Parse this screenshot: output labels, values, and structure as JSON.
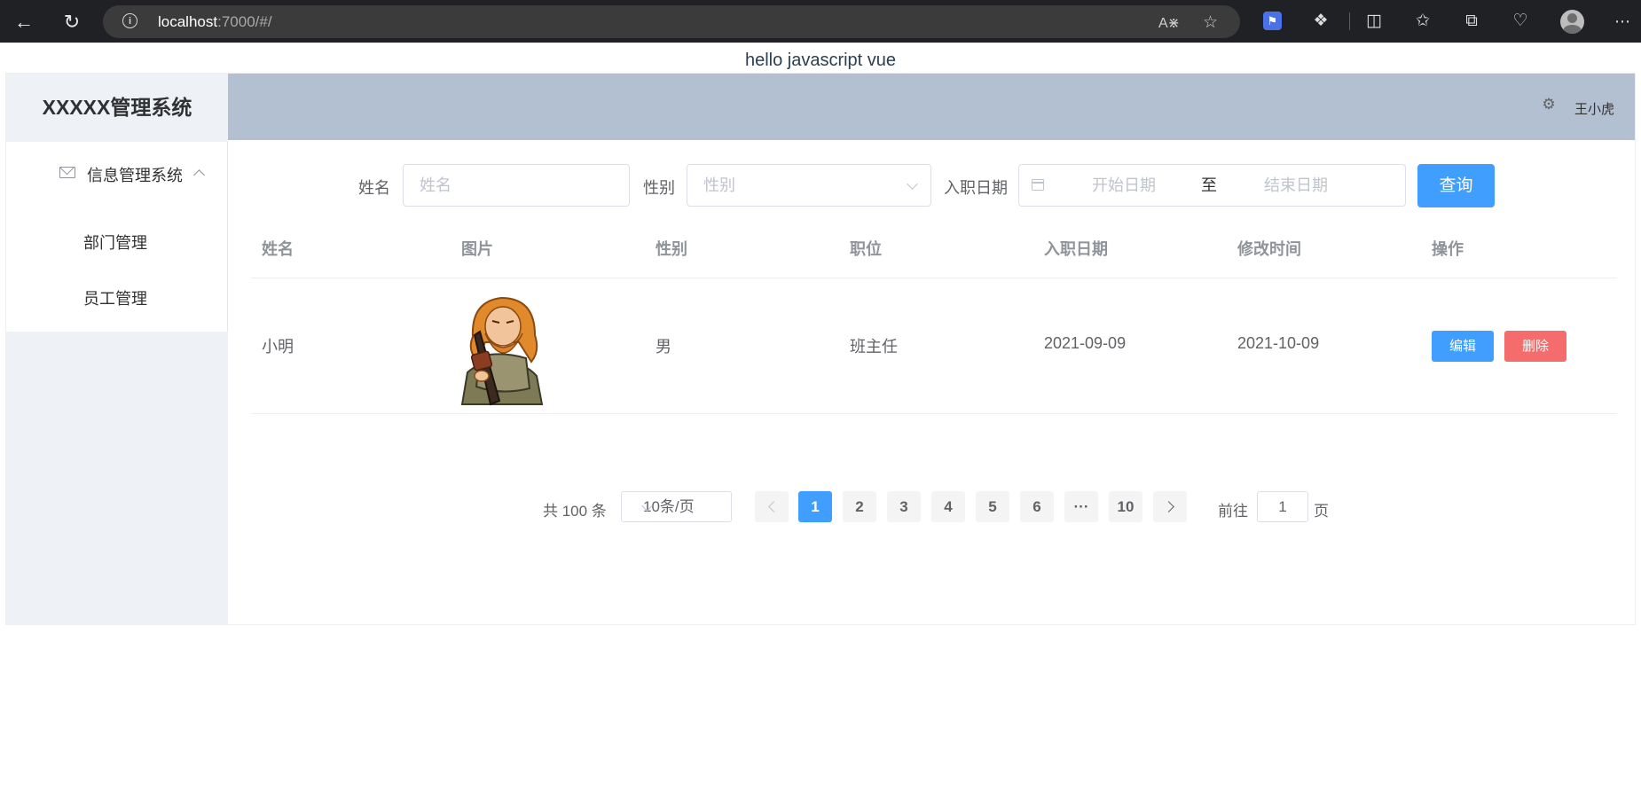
{
  "browser": {
    "url_host": "localhost",
    "url_path": ":7000/#/",
    "icons": [
      "back-icon",
      "refresh-icon",
      "info-icon",
      "read-aloud-icon",
      "favorite-icon",
      "extension-icon",
      "puzzle-icon",
      "split-screen-icon",
      "favorites-icon",
      "collections-icon",
      "health-icon",
      "profile-icon",
      "more-icon"
    ]
  },
  "page": {
    "heading": "hello javascript vue"
  },
  "sidebar": {
    "logo": "XXXXX管理系统",
    "submenu": {
      "label": "信息管理系统",
      "icon": "mail-icon"
    },
    "items": [
      {
        "label": "部门管理"
      },
      {
        "label": "员工管理"
      }
    ]
  },
  "header": {
    "user": "王小虎",
    "icon": "gear-icon"
  },
  "filters": {
    "name": {
      "label": "姓名",
      "placeholder": "姓名"
    },
    "gender": {
      "label": "性别",
      "placeholder": "性别"
    },
    "date": {
      "label": "入职日期",
      "start_placeholder": "开始日期",
      "separator": "至",
      "end_placeholder": "结束日期"
    },
    "search_label": "查询"
  },
  "table": {
    "columns": [
      "姓名",
      "图片",
      "性别",
      "职位",
      "入职日期",
      "修改时间",
      "操作"
    ],
    "rows": [
      {
        "name": "小明",
        "gender": "男",
        "position": "班主任",
        "entry_date": "2021-09-09",
        "update_time": "2021-10-09",
        "edit_label": "编辑",
        "delete_label": "删除"
      }
    ]
  },
  "pagination": {
    "total_text": "共 100 条",
    "page_size": "10条/页",
    "pages": [
      "1",
      "2",
      "3",
      "4",
      "5",
      "6",
      "···",
      "10"
    ],
    "current_page": "1",
    "goto_prefix": "前往",
    "goto_value": "1",
    "goto_suffix": "页"
  },
  "colors": {
    "primary": "#409eff",
    "danger": "#f56c6c",
    "header_bg": "#b3c0d1",
    "aside_bg": "#eef1f6"
  }
}
